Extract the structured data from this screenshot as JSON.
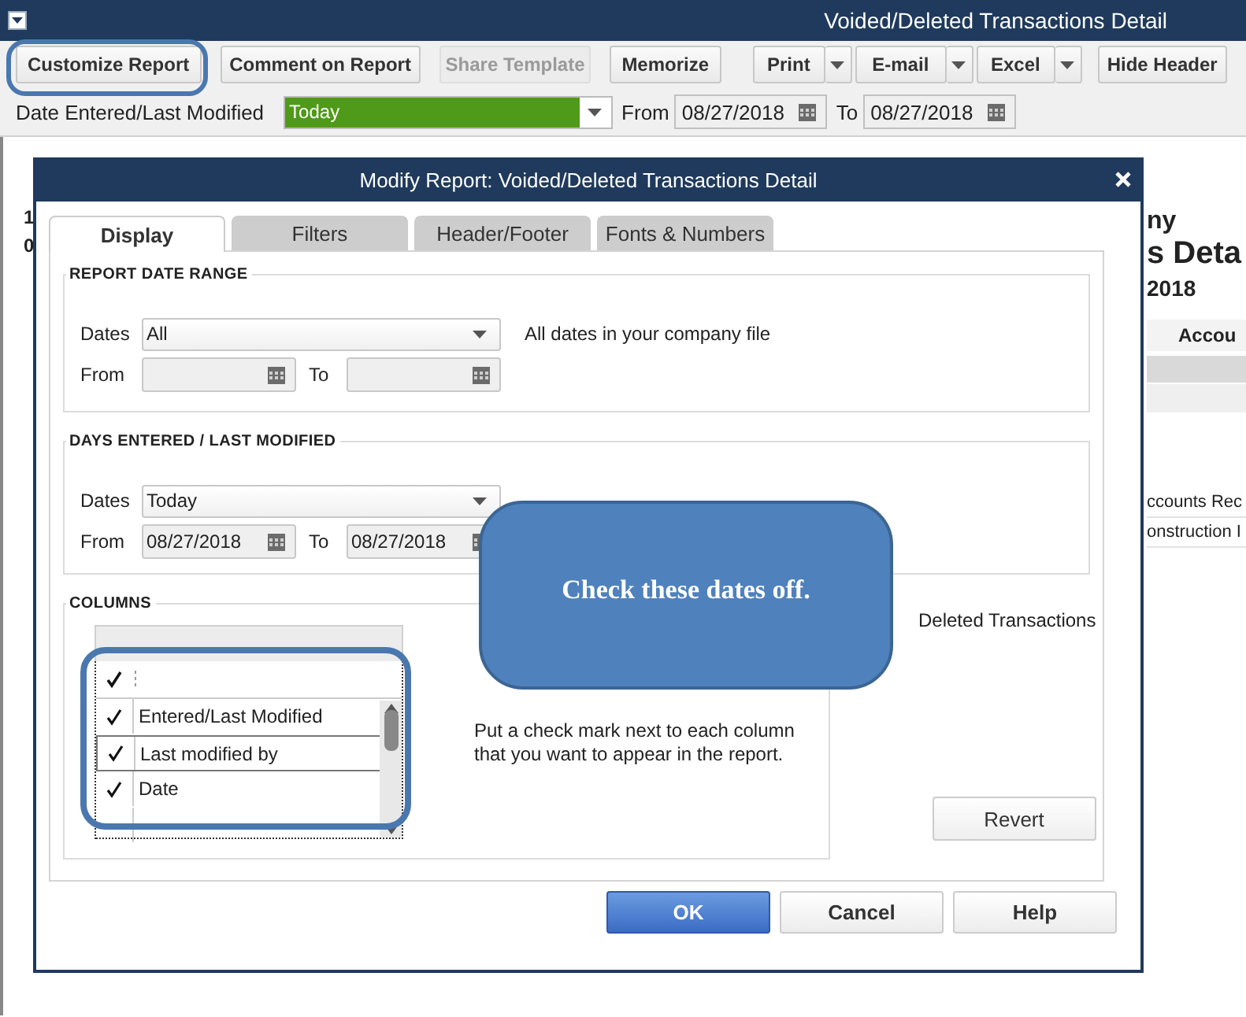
{
  "window": {
    "title": "Voided/Deleted Transactions Detail"
  },
  "toolbar": {
    "buttons": [
      {
        "label": "Customize Report",
        "kind": "button",
        "disabled": false
      },
      {
        "label": "Comment on Report",
        "kind": "button",
        "disabled": false
      },
      {
        "label": "Share Template",
        "kind": "button",
        "disabled": true
      },
      {
        "label": "Memorize",
        "kind": "button",
        "disabled": false
      },
      {
        "label": "Print",
        "kind": "split",
        "disabled": false
      },
      {
        "label": "E-mail",
        "kind": "split",
        "disabled": false
      },
      {
        "label": "Excel",
        "kind": "split",
        "disabled": false
      },
      {
        "label": "Hide Header",
        "kind": "button",
        "disabled": false
      }
    ]
  },
  "filter": {
    "label": "Date Entered/Last Modified",
    "period": "Today",
    "from_label": "From",
    "from": "08/27/2018",
    "to_label": "To",
    "to": "08/27/2018"
  },
  "report": {
    "left_fragments": [
      "1",
      "0"
    ],
    "title_fragments": [
      "ny",
      "s Deta",
      "2018"
    ],
    "column_header": "Accou",
    "row_fragments": [
      "ccounts Rec",
      "onstruction I"
    ]
  },
  "dialog": {
    "title": "Modify Report: Voided/Deleted Transactions Detail",
    "tabs": [
      {
        "label": "Display",
        "selected": true
      },
      {
        "label": "Filters",
        "selected": false
      },
      {
        "label": "Header/Footer",
        "selected": false
      },
      {
        "label": "Fonts & Numbers",
        "selected": false
      }
    ],
    "groups": [
      {
        "heading": "REPORT DATE RANGE",
        "dates_label": "Dates",
        "dates_value": "All",
        "note": "All dates in your company file",
        "from_label": "From",
        "to_label": "To"
      },
      {
        "heading": "DAYS ENTERED / LAST MODIFIED",
        "dates_label": "Dates",
        "dates_value": "Today",
        "from_label": "From",
        "from": "08/27/2018",
        "to_label": "To",
        "to": "08/27/2018"
      }
    ],
    "columns": {
      "heading": "COLUMNS",
      "items": [
        {
          "label": "Entered/Last Modified",
          "checked": true,
          "selected": false
        },
        {
          "label": "Last modified by",
          "checked": true,
          "selected": true
        },
        {
          "label": "Date",
          "checked": true,
          "selected": false
        }
      ],
      "hint": "Put a check mark next to each column that you want to appear in the report.",
      "option_label": "Deleted Transactions",
      "revert": "Revert"
    },
    "buttons": [
      {
        "label": "OK",
        "kind": "primary"
      },
      {
        "label": "Cancel",
        "kind": "normal"
      },
      {
        "label": "Help",
        "kind": "normal"
      }
    ]
  },
  "callout": {
    "text": "Check these dates off."
  }
}
